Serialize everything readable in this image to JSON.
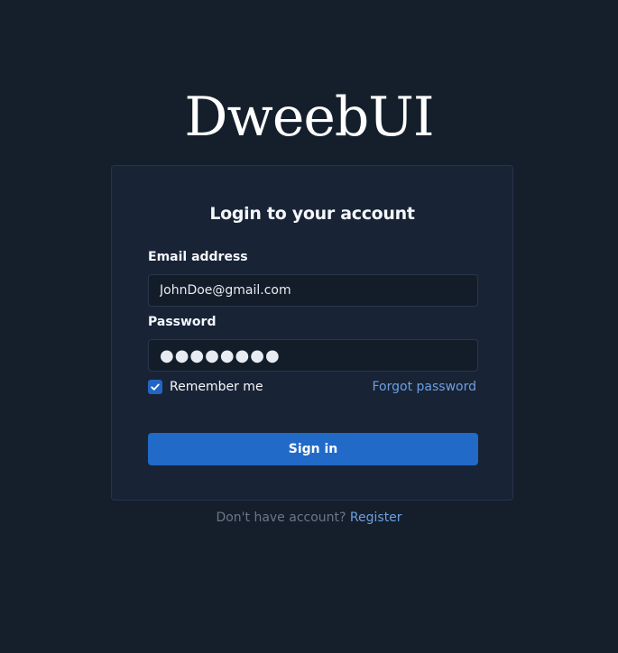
{
  "brand": {
    "logo_text": "DweebUI"
  },
  "login": {
    "title": "Login to your account",
    "email_label": "Email address",
    "email_value": "JohnDoe@gmail.com",
    "password_label": "Password",
    "password_mask": "●●●●●●●●",
    "remember_label": "Remember me",
    "remember_checked": true,
    "forgot_link": "Forgot password",
    "submit_label": "Sign in"
  },
  "footer": {
    "prompt": "Don't have account?",
    "register_link": "Register"
  },
  "colors": {
    "background": "#151f2c",
    "card": "#182335",
    "accent": "#216ac8",
    "link": "#6d9fe0"
  }
}
